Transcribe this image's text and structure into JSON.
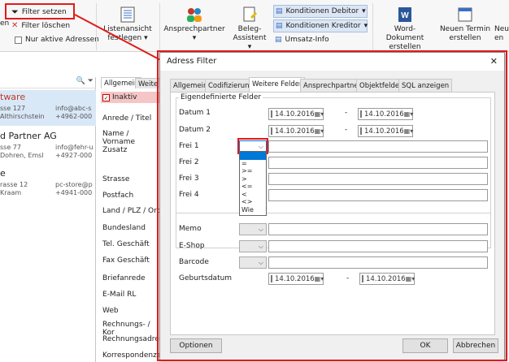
{
  "ribbon": {
    "filter_set": "Filter setzen",
    "filter_clear": "Filter löschen",
    "left_cut": "en",
    "inactive_addresses": "Nur aktive Adressen",
    "list_view": "Listenansicht",
    "list_view2": "festlegen ▾",
    "contact": "Ansprechpartner",
    "contact2": "▾",
    "doc_assist": "Beleg-",
    "doc_assist2": "Assistent ▾",
    "cond_debtor": "Konditionen Debitor",
    "cond_creditor": "Konditionen Kreditor",
    "vat": "Umsatz-Info",
    "word_doc": "Word-Dokument",
    "word_doc2": "erstellen",
    "new_date": "Neuen Termin",
    "new_date2": "erstellen",
    "new_cut": "Neu",
    "new_cut2": "en"
  },
  "list": {
    "items": [
      {
        "name": "tware",
        "addr": "sse 127",
        "email": "info@abc-s",
        "city": "Althirschstein",
        "phone": "+4962-000"
      },
      {
        "name": "d Partner AG",
        "addr": "sse 77",
        "email": "info@fehr-u",
        "city": "Dohren, Emsl",
        "phone": "+4927-000"
      },
      {
        "name": "e",
        "addr": "rasse 12",
        "email": "pc-store@p",
        "city": "Kraam",
        "phone": "+4941-000"
      }
    ]
  },
  "mid": {
    "tab1": "Allgemein",
    "tab2": "Weite",
    "inactive": "Inaktiv",
    "fields": [
      "Anrede / Titel",
      "Name / Vorname",
      "Zusatz",
      "Strasse",
      "Postfach",
      "Land / PLZ / Ort",
      "Bundesland",
      "Tel. Geschäft",
      "Fax Geschäft",
      "Briefanrede",
      "E-Mail  RL",
      "Web",
      "Rechnungs- / Kor",
      "Rechnungsadres",
      "Korrespondenzad"
    ]
  },
  "dialog": {
    "title": "Adress Filter",
    "close": "✕",
    "tabs": [
      "Allgemein",
      "Codifizierung",
      "Weitere Felder",
      "Ansprechpartner",
      "Objektfelder",
      "SQL anzeigen"
    ],
    "group_title": "Eigendefinierte Felder",
    "datum1": "Datum 1",
    "datum2": "Datum 2",
    "frei": [
      "Frei 1",
      "Frei 2",
      "Frei 3",
      "Frei 4"
    ],
    "date_value": "14.10.2016",
    "dash": "-",
    "memo": "Memo",
    "eshop": "E-Shop",
    "barcode": "Barcode",
    "birthday": "Geburtsdatum",
    "dropdown_options": [
      "",
      "=",
      ">=",
      ">",
      "<=",
      "<",
      "<>",
      "Wie"
    ],
    "options_btn": "Optionen",
    "ok_btn": "OK",
    "cancel_btn": "Abbrechen"
  },
  "colors": {
    "highlight": "#e21a1a",
    "selected": "#0078d7",
    "list_blue": "#d9e8f7"
  }
}
